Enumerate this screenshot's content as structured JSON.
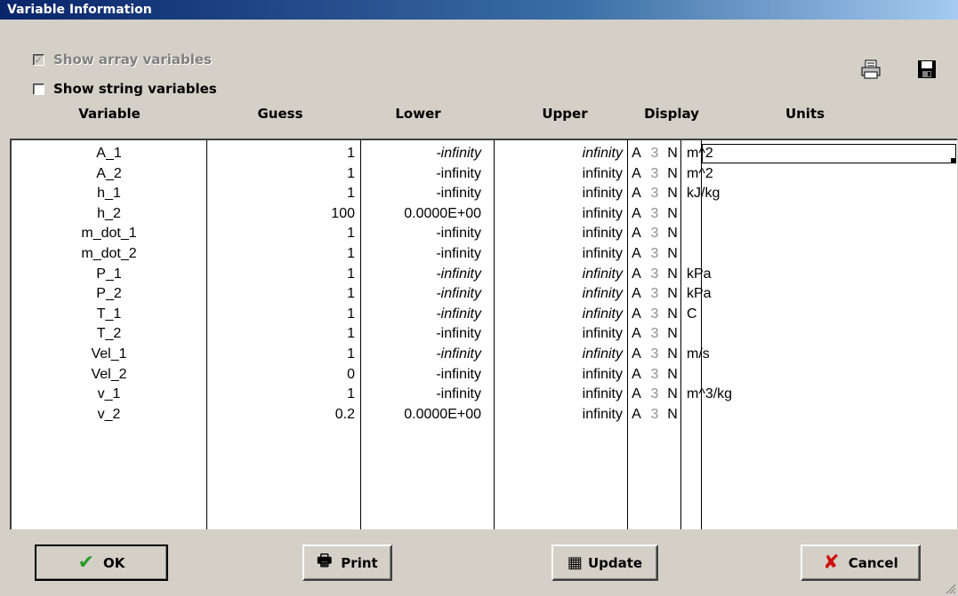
{
  "window": {
    "title": "Variable Information"
  },
  "options": {
    "show_array": {
      "label": "Show array variables",
      "checked": true,
      "enabled": false
    },
    "show_string": {
      "label": "Show string variables",
      "checked": false,
      "enabled": true
    }
  },
  "toolbar": {
    "print_icon": "print-preview-icon",
    "save_icon": "floppy-disk-icon"
  },
  "columns": {
    "variable": "Variable",
    "guess": "Guess",
    "lower": "Lower",
    "upper": "Upper",
    "display": "Display",
    "units": "Units"
  },
  "rows": [
    {
      "name": "A_1",
      "guess": "1",
      "lower": "-infinity",
      "upper": "infinity",
      "fmt": "A",
      "digits": "3",
      "notation": "N",
      "units": "m^2",
      "ital": true
    },
    {
      "name": "A_2",
      "guess": "1",
      "lower": "-infinity",
      "upper": "infinity",
      "fmt": "A",
      "digits": "3",
      "notation": "N",
      "units": "m^2",
      "ital": false
    },
    {
      "name": "h_1",
      "guess": "1",
      "lower": "-infinity",
      "upper": "infinity",
      "fmt": "A",
      "digits": "3",
      "notation": "N",
      "units": "kJ/kg",
      "ital": false
    },
    {
      "name": "h_2",
      "guess": "100",
      "lower": "0.0000E+00",
      "upper": "infinity",
      "fmt": "A",
      "digits": "3",
      "notation": "N",
      "units": "",
      "ital": false
    },
    {
      "name": "m_dot_1",
      "guess": "1",
      "lower": "-infinity",
      "upper": "infinity",
      "fmt": "A",
      "digits": "3",
      "notation": "N",
      "units": "",
      "ital": false
    },
    {
      "name": "m_dot_2",
      "guess": "1",
      "lower": "-infinity",
      "upper": "infinity",
      "fmt": "A",
      "digits": "3",
      "notation": "N",
      "units": "",
      "ital": false
    },
    {
      "name": "P_1",
      "guess": "1",
      "lower": "-infinity",
      "upper": "infinity",
      "fmt": "A",
      "digits": "3",
      "notation": "N",
      "units": "kPa",
      "ital": true
    },
    {
      "name": "P_2",
      "guess": "1",
      "lower": "-infinity",
      "upper": "infinity",
      "fmt": "A",
      "digits": "3",
      "notation": "N",
      "units": "kPa",
      "ital": true
    },
    {
      "name": "T_1",
      "guess": "1",
      "lower": "-infinity",
      "upper": "infinity",
      "fmt": "A",
      "digits": "3",
      "notation": "N",
      "units": "C",
      "ital": true
    },
    {
      "name": "T_2",
      "guess": "1",
      "lower": "-infinity",
      "upper": "infinity",
      "fmt": "A",
      "digits": "3",
      "notation": "N",
      "units": "",
      "ital": false
    },
    {
      "name": "Vel_1",
      "guess": "1",
      "lower": "-infinity",
      "upper": "infinity",
      "fmt": "A",
      "digits": "3",
      "notation": "N",
      "units": "m/s",
      "ital": true
    },
    {
      "name": "Vel_2",
      "guess": "0",
      "lower": "-infinity",
      "upper": "infinity",
      "fmt": "A",
      "digits": "3",
      "notation": "N",
      "units": "",
      "ital": false
    },
    {
      "name": "v_1",
      "guess": "1",
      "lower": "-infinity",
      "upper": "infinity",
      "fmt": "A",
      "digits": "3",
      "notation": "N",
      "units": "m^3/kg",
      "ital": false
    },
    {
      "name": "v_2",
      "guess": "0.2",
      "lower": "0.0000E+00",
      "upper": "infinity",
      "fmt": "A",
      "digits": "3",
      "notation": "N",
      "units": "",
      "ital": false
    }
  ],
  "buttons": {
    "ok": {
      "label": "OK",
      "icon": "checkmark-icon"
    },
    "print": {
      "label": "Print",
      "icon": "printer-icon"
    },
    "update": {
      "label": "Update",
      "icon": "update-icon"
    },
    "cancel": {
      "label": "Cancel",
      "icon": "red-x-icon"
    }
  },
  "colors": {
    "title_bar": "#0a246a",
    "dialog_bg": "#d4d0c8",
    "ok_check": "#2a9a2a",
    "cancel_x": "#d01010"
  }
}
